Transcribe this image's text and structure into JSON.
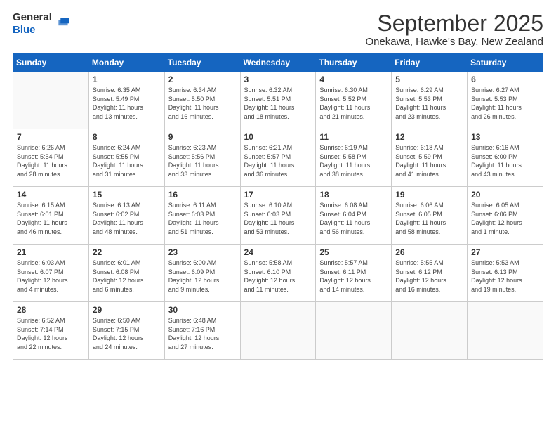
{
  "logo": {
    "general": "General",
    "blue": "Blue"
  },
  "header": {
    "month": "September 2025",
    "location": "Onekawa, Hawke's Bay, New Zealand"
  },
  "days_of_week": [
    "Sunday",
    "Monday",
    "Tuesday",
    "Wednesday",
    "Thursday",
    "Friday",
    "Saturday"
  ],
  "weeks": [
    [
      {
        "day": "",
        "info": ""
      },
      {
        "day": "1",
        "info": "Sunrise: 6:35 AM\nSunset: 5:49 PM\nDaylight: 11 hours\nand 13 minutes."
      },
      {
        "day": "2",
        "info": "Sunrise: 6:34 AM\nSunset: 5:50 PM\nDaylight: 11 hours\nand 16 minutes."
      },
      {
        "day": "3",
        "info": "Sunrise: 6:32 AM\nSunset: 5:51 PM\nDaylight: 11 hours\nand 18 minutes."
      },
      {
        "day": "4",
        "info": "Sunrise: 6:30 AM\nSunset: 5:52 PM\nDaylight: 11 hours\nand 21 minutes."
      },
      {
        "day": "5",
        "info": "Sunrise: 6:29 AM\nSunset: 5:53 PM\nDaylight: 11 hours\nand 23 minutes."
      },
      {
        "day": "6",
        "info": "Sunrise: 6:27 AM\nSunset: 5:53 PM\nDaylight: 11 hours\nand 26 minutes."
      }
    ],
    [
      {
        "day": "7",
        "info": "Sunrise: 6:26 AM\nSunset: 5:54 PM\nDaylight: 11 hours\nand 28 minutes."
      },
      {
        "day": "8",
        "info": "Sunrise: 6:24 AM\nSunset: 5:55 PM\nDaylight: 11 hours\nand 31 minutes."
      },
      {
        "day": "9",
        "info": "Sunrise: 6:23 AM\nSunset: 5:56 PM\nDaylight: 11 hours\nand 33 minutes."
      },
      {
        "day": "10",
        "info": "Sunrise: 6:21 AM\nSunset: 5:57 PM\nDaylight: 11 hours\nand 36 minutes."
      },
      {
        "day": "11",
        "info": "Sunrise: 6:19 AM\nSunset: 5:58 PM\nDaylight: 11 hours\nand 38 minutes."
      },
      {
        "day": "12",
        "info": "Sunrise: 6:18 AM\nSunset: 5:59 PM\nDaylight: 11 hours\nand 41 minutes."
      },
      {
        "day": "13",
        "info": "Sunrise: 6:16 AM\nSunset: 6:00 PM\nDaylight: 11 hours\nand 43 minutes."
      }
    ],
    [
      {
        "day": "14",
        "info": "Sunrise: 6:15 AM\nSunset: 6:01 PM\nDaylight: 11 hours\nand 46 minutes."
      },
      {
        "day": "15",
        "info": "Sunrise: 6:13 AM\nSunset: 6:02 PM\nDaylight: 11 hours\nand 48 minutes."
      },
      {
        "day": "16",
        "info": "Sunrise: 6:11 AM\nSunset: 6:03 PM\nDaylight: 11 hours\nand 51 minutes."
      },
      {
        "day": "17",
        "info": "Sunrise: 6:10 AM\nSunset: 6:03 PM\nDaylight: 11 hours\nand 53 minutes."
      },
      {
        "day": "18",
        "info": "Sunrise: 6:08 AM\nSunset: 6:04 PM\nDaylight: 11 hours\nand 56 minutes."
      },
      {
        "day": "19",
        "info": "Sunrise: 6:06 AM\nSunset: 6:05 PM\nDaylight: 11 hours\nand 58 minutes."
      },
      {
        "day": "20",
        "info": "Sunrise: 6:05 AM\nSunset: 6:06 PM\nDaylight: 12 hours\nand 1 minute."
      }
    ],
    [
      {
        "day": "21",
        "info": "Sunrise: 6:03 AM\nSunset: 6:07 PM\nDaylight: 12 hours\nand 4 minutes."
      },
      {
        "day": "22",
        "info": "Sunrise: 6:01 AM\nSunset: 6:08 PM\nDaylight: 12 hours\nand 6 minutes."
      },
      {
        "day": "23",
        "info": "Sunrise: 6:00 AM\nSunset: 6:09 PM\nDaylight: 12 hours\nand 9 minutes."
      },
      {
        "day": "24",
        "info": "Sunrise: 5:58 AM\nSunset: 6:10 PM\nDaylight: 12 hours\nand 11 minutes."
      },
      {
        "day": "25",
        "info": "Sunrise: 5:57 AM\nSunset: 6:11 PM\nDaylight: 12 hours\nand 14 minutes."
      },
      {
        "day": "26",
        "info": "Sunrise: 5:55 AM\nSunset: 6:12 PM\nDaylight: 12 hours\nand 16 minutes."
      },
      {
        "day": "27",
        "info": "Sunrise: 5:53 AM\nSunset: 6:13 PM\nDaylight: 12 hours\nand 19 minutes."
      }
    ],
    [
      {
        "day": "28",
        "info": "Sunrise: 6:52 AM\nSunset: 7:14 PM\nDaylight: 12 hours\nand 22 minutes."
      },
      {
        "day": "29",
        "info": "Sunrise: 6:50 AM\nSunset: 7:15 PM\nDaylight: 12 hours\nand 24 minutes."
      },
      {
        "day": "30",
        "info": "Sunrise: 6:48 AM\nSunset: 7:16 PM\nDaylight: 12 hours\nand 27 minutes."
      },
      {
        "day": "",
        "info": ""
      },
      {
        "day": "",
        "info": ""
      },
      {
        "day": "",
        "info": ""
      },
      {
        "day": "",
        "info": ""
      }
    ]
  ]
}
